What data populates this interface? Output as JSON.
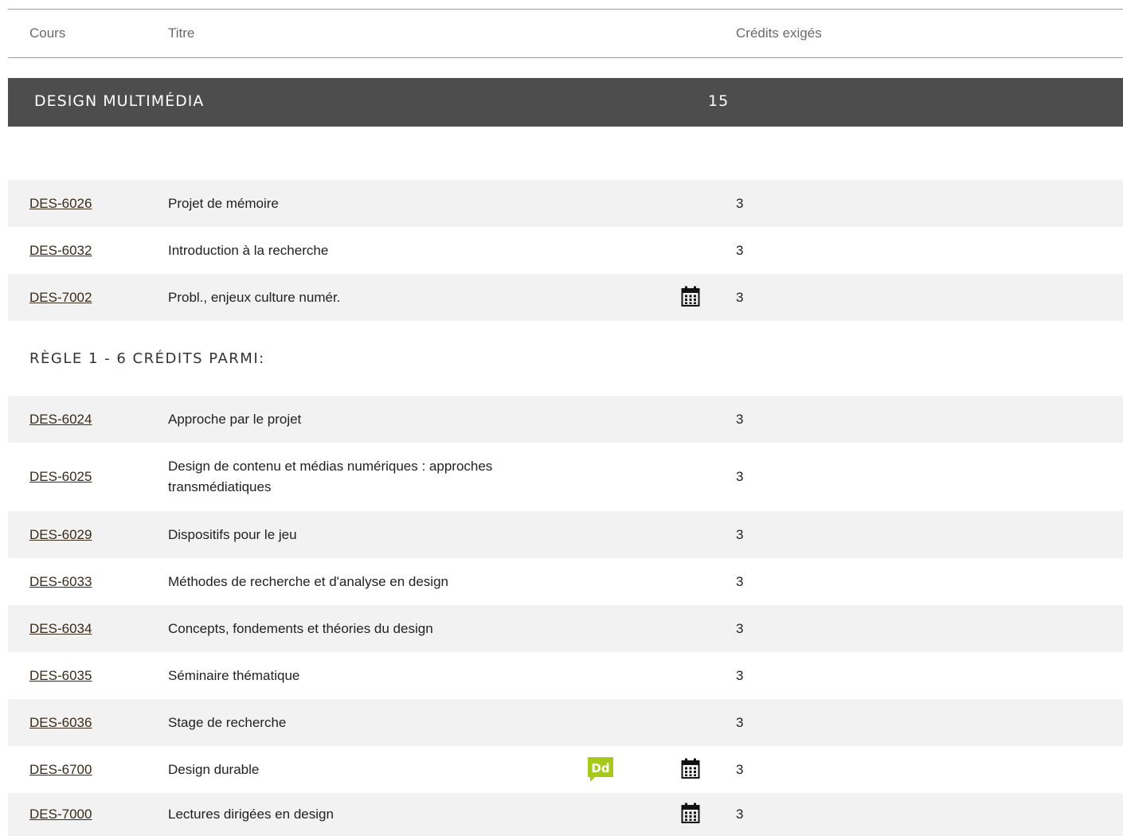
{
  "header": {
    "col_course": "Cours",
    "col_title": "Titre",
    "col_credits": "Crédits exigés"
  },
  "section": {
    "name": "DESIGN MULTIMÉDIA",
    "credits": "15"
  },
  "required_courses": [
    {
      "code": "DES-6026",
      "title": "Projet de mémoire",
      "credits": "3",
      "schedule_icon": false,
      "dd_icon": false
    },
    {
      "code": "DES-6032",
      "title": "Introduction à la recherche",
      "credits": "3",
      "schedule_icon": false,
      "dd_icon": false
    },
    {
      "code": "DES-7002",
      "title": "Probl., enjeux culture numér.",
      "credits": "3",
      "schedule_icon": true,
      "dd_icon": false
    }
  ],
  "rule": {
    "label": "RÈGLE 1 - 6 CRÉDITS PARMI:"
  },
  "rule_courses": [
    {
      "code": "DES-6024",
      "title": "Approche par le projet",
      "credits": "3",
      "schedule_icon": false,
      "dd_icon": false
    },
    {
      "code": "DES-6025",
      "title": "Design de contenu et médias numériques : approches transmédiatiques",
      "credits": "3",
      "schedule_icon": false,
      "dd_icon": false
    },
    {
      "code": "DES-6029",
      "title": "Dispositifs pour le jeu",
      "credits": "3",
      "schedule_icon": false,
      "dd_icon": false
    },
    {
      "code": "DES-6033",
      "title": "Méthodes de recherche et d'analyse en design",
      "credits": "3",
      "schedule_icon": false,
      "dd_icon": false
    },
    {
      "code": "DES-6034",
      "title": "Concepts, fondements et théories du design",
      "credits": "3",
      "schedule_icon": false,
      "dd_icon": false
    },
    {
      "code": "DES-6035",
      "title": "Séminaire thématique",
      "credits": "3",
      "schedule_icon": false,
      "dd_icon": false
    },
    {
      "code": "DES-6036",
      "title": "Stage de recherche",
      "credits": "3",
      "schedule_icon": false,
      "dd_icon": false
    },
    {
      "code": "DES-6700",
      "title": "Design durable",
      "credits": "3",
      "schedule_icon": true,
      "dd_icon": true
    },
    {
      "code": "DES-7000",
      "title": "Lectures dirigées en design",
      "credits": "3",
      "schedule_icon": true,
      "dd_icon": false
    }
  ],
  "icons": {
    "schedule": "calendar-icon",
    "sustainable": "dd-sustainable-design-icon"
  },
  "colors": {
    "section_bar": "#4d4d4d",
    "row_bg": "#f2f2f2",
    "dd_badge": "#a6c91a"
  }
}
